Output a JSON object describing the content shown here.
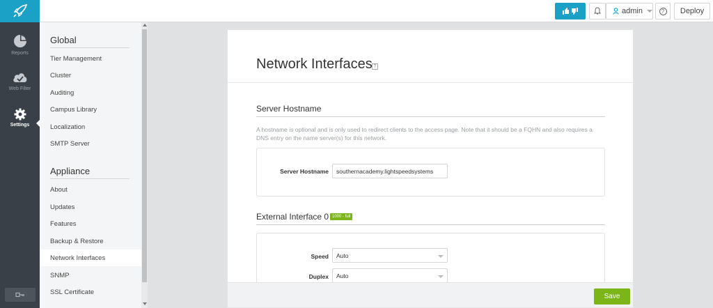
{
  "topbar": {
    "user_label": "admin",
    "deploy_label": "Deploy",
    "help_glyph": "?"
  },
  "rail": {
    "items": [
      {
        "label": "Reports",
        "icon": "pie-chart-icon"
      },
      {
        "label": "Web Filter",
        "icon": "cloud-icon"
      },
      {
        "label": "Settings",
        "icon": "gear-icon"
      }
    ]
  },
  "subnav": {
    "sections": [
      {
        "title": "Global",
        "items": [
          "Tier Management",
          "Cluster",
          "Auditing",
          "Campus Library",
          "Localization",
          "SMTP Server"
        ]
      },
      {
        "title": "Appliance",
        "items": [
          "About",
          "Updates",
          "Features",
          "Backup & Restore",
          "Network Interfaces",
          "SNMP",
          "SSL Certificate"
        ]
      }
    ],
    "active": "Network Interfaces"
  },
  "main": {
    "title": "Network Interfaces",
    "hostname_section": {
      "title": "Server Hostname",
      "description": "A hostname is optional and is only used to redirect clients to the access page. Note that it should be a FQHN and also requires a DNS entry on the name server(s) for this network.",
      "field_label": "Server Hostname",
      "field_value": "southernacademy.lightspeedsystems"
    },
    "external_section": {
      "title": "External Interface 0",
      "badge": "1000 - full",
      "speed_label": "Speed",
      "speed_value": "Auto",
      "duplex_label": "Duplex",
      "duplex_value": "Auto"
    },
    "save_label": "Save"
  },
  "colors": {
    "brand": "#1ba1c6",
    "rail_bg": "#3a4047",
    "save_green": "#7cb518"
  }
}
